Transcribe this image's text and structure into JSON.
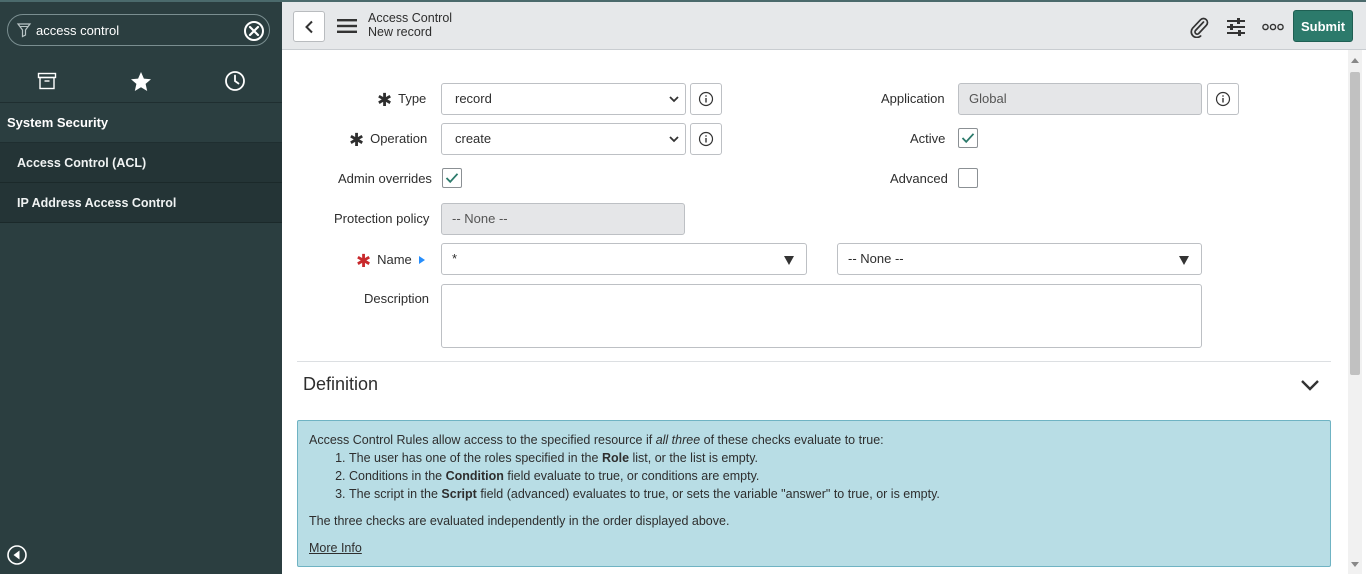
{
  "nav": {
    "filter_value": "access control",
    "tabs": [
      {
        "icon": "archive-icon"
      },
      {
        "icon": "star-icon"
      },
      {
        "icon": "clock-icon"
      }
    ],
    "group": "System Security",
    "modules": [
      "Access Control (ACL)",
      "IP Address Access Control"
    ]
  },
  "header": {
    "title": "Access Control",
    "subtitle": "New record",
    "submit_label": "Submit"
  },
  "form": {
    "type_label": "Type",
    "type_value": "record",
    "operation_label": "Operation",
    "operation_value": "create",
    "admin_overrides_label": "Admin overrides",
    "admin_overrides_checked": true,
    "protection_policy_label": "Protection policy",
    "protection_policy_value": "-- None --",
    "name_label": "Name",
    "name_table_value": "*",
    "name_field_value": "-- None --",
    "description_label": "Description",
    "description_value": "",
    "application_label": "Application",
    "application_value": "Global",
    "active_label": "Active",
    "active_checked": true,
    "advanced_label": "Advanced",
    "advanced_checked": false
  },
  "definition": {
    "title": "Definition",
    "intro_a": "Access Control Rules allow access to the specified resource if ",
    "intro_em": "all three",
    "intro_b": " of these checks evaluate to true:",
    "item1_a": "The user has one of the roles specified in the ",
    "item1_b": "Role",
    "item1_c": " list, or the list is empty.",
    "item2_a": "Conditions in the ",
    "item2_b": "Condition",
    "item2_c": " field evaluate to true, or conditions are empty.",
    "item3_a": "The script in the ",
    "item3_b": "Script",
    "item3_c": " field (advanced) evaluates to true, or sets the variable \"answer\" to true, or is empty.",
    "summary": "The three checks are evaluated independently in the order displayed above.",
    "more_info": "More Info"
  },
  "colors": {
    "nav_bg": "#2b3e40",
    "submit_bg": "#2c7a6b",
    "info_bg": "#b8dde5",
    "required_red": "#c8292c"
  }
}
